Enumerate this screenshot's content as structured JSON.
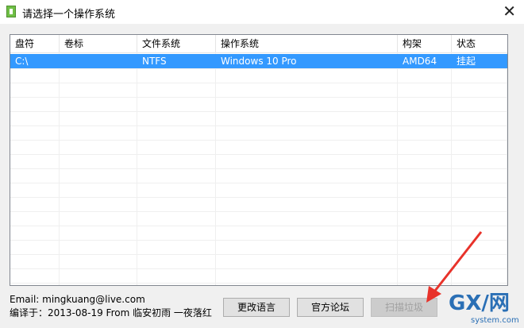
{
  "window": {
    "title": "请选择一个操作系统",
    "close_glyph": "✕"
  },
  "table": {
    "columns": [
      "盘符",
      "卷标",
      "文件系统",
      "操作系统",
      "构架",
      "状态"
    ],
    "rows": [
      {
        "drive": "C:\\",
        "label": "",
        "fs": "NTFS",
        "os": "Windows 10 Pro",
        "arch": "AMD64",
        "status": "挂起",
        "selected": true
      }
    ]
  },
  "footer": {
    "email": "Email: mingkuang@live.com",
    "compiled": "编译于：2013-08-19 From 临安初雨 一夜落红"
  },
  "buttons": {
    "change_language": "更改语言",
    "forum": "官方论坛",
    "scan": "扫描垃圾",
    "scan_disabled": true
  },
  "watermark": {
    "text_main": "GX/网",
    "text_sub": "system.com"
  },
  "colors": {
    "selection": "#3399ff",
    "accent_arrow": "#e8322a"
  }
}
